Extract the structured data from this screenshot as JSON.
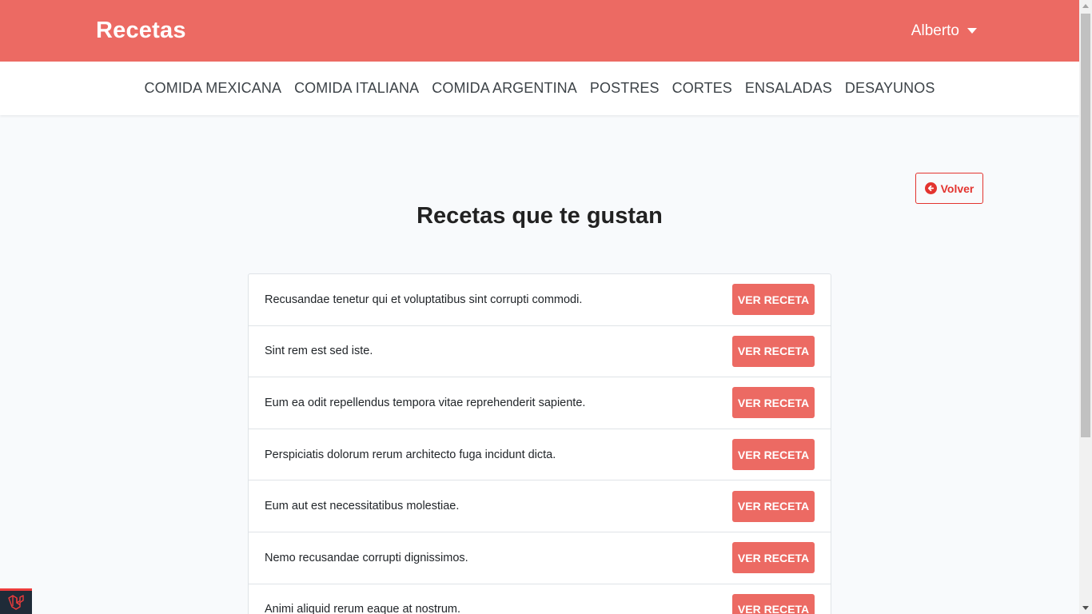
{
  "header": {
    "brand": "Recetas",
    "user_name": "Alberto"
  },
  "categories": [
    "Comida Mexicana",
    "Comida Italiana",
    "Comida Argentina",
    "Postres",
    "Cortes",
    "Ensaladas",
    "Desayunos"
  ],
  "main": {
    "back_label": "Volver",
    "title": "Recetas que te gustan",
    "view_label": "Ver Receta",
    "recipes": [
      "Recusandae tenetur qui et voluptatibus sint corrupti commodi.",
      "Sint rem est sed iste.",
      "Eum ea odit repellendus tempora vitae reprehenderit sapiente.",
      "Perspiciatis dolorum rerum architecto fuga incidunt dicta.",
      "Eum aut est necessitatibus molestiae.",
      "Nemo recusandae corrupti dignissimos.",
      "Animi aliquid rerum eaque at nostrum."
    ]
  },
  "colors": {
    "brand": "#ec6a63",
    "danger": "#e3342f",
    "background": "#f8fafc"
  },
  "icons": {
    "back": "arrow-circle-left-icon",
    "dropdown": "caret-down-icon",
    "debug": "laravel-icon"
  }
}
